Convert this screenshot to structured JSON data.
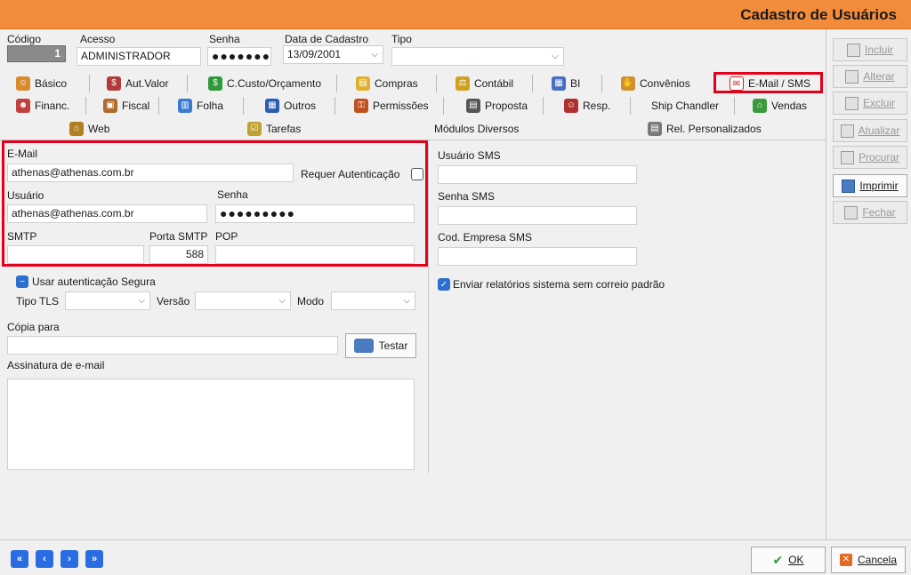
{
  "window": {
    "title": "Cadastro de Usuários"
  },
  "header": {
    "codigo_label": "Código",
    "codigo_value": "1",
    "acesso_label": "Acesso",
    "acesso_value": "ADMINISTRADOR",
    "senha_label": "Senha",
    "senha_value": "●●●●●●●",
    "data_label": "Data de Cadastro",
    "data_value": "13/09/2001",
    "tipo_label": "Tipo",
    "tipo_value": ""
  },
  "tabs_row1": [
    "Básico",
    "Aut.Valor",
    "C.Custo/Orçamento",
    "Compras",
    "Contábil",
    "BI",
    "Convênios",
    "E-Mail / SMS"
  ],
  "tabs_row2": [
    "Financ.",
    "Fiscal",
    "Folha",
    "Outros",
    "Permissões",
    "Proposta",
    "Resp.",
    "Ship Chandler",
    "Vendas"
  ],
  "tabs_row3": [
    "Web",
    "Tarefas",
    "Módulos Diversos",
    "Rel. Personalizados"
  ],
  "email": {
    "email_label": "E-Mail",
    "email_value": "athenas@athenas.com.br",
    "requer_label": "Requer Autenticação",
    "usuario_label": "Usuário",
    "usuario_value": "athenas@athenas.com.br",
    "senha_label": "Senha",
    "senha_value": "●●●●●●●●●",
    "smtp_label": "SMTP",
    "smtp_value": "",
    "porta_label": "Porta SMTP",
    "porta_value": "588",
    "pop_label": "POP",
    "pop_value": "",
    "seg_label": "Usar autenticação Segura",
    "tls_label": "Tipo TLS",
    "versao_label": "Versão",
    "modo_label": "Modo",
    "copia_label": "Cópia para",
    "copia_value": "",
    "testar_label": "Testar",
    "assinatura_label": "Assinatura de e-mail"
  },
  "sms": {
    "usuario_label": "Usuário SMS",
    "senha_label": "Senha SMS",
    "cod_label": "Cod. Empresa SMS",
    "enviar_label": "Enviar relatórios sistema sem correio padrão"
  },
  "side": [
    "Incluir",
    "Alterar",
    "Excluir",
    "Atualizar",
    "Procurar",
    "Imprimir",
    "Fechar"
  ],
  "footer": {
    "nav": [
      "«",
      "‹",
      "›",
      "»"
    ],
    "ok_label": "OK",
    "cancel_label": "Cancela"
  },
  "colors": {
    "titlebar": "#f38c3a",
    "highlight": "#e3001b",
    "accent": "#2d6fce"
  }
}
